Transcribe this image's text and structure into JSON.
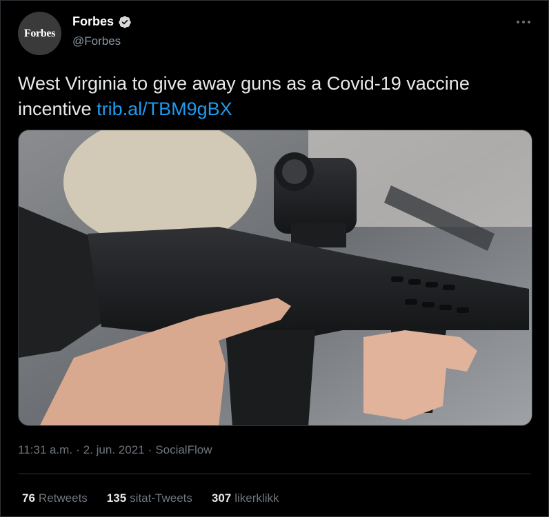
{
  "author": {
    "avatar_text": "Forbes",
    "display_name": "Forbes",
    "handle": "@Forbes",
    "verified": true
  },
  "tweet": {
    "text": "West Virginia to give away guns as a Covid-19 vaccine incentive ",
    "link": "trib.al/TBM9gBX"
  },
  "media": {
    "description": "photo"
  },
  "meta": {
    "time": "11:31 a.m.",
    "separator": "·",
    "date": "2. jun. 2021",
    "source": "SocialFlow"
  },
  "stats": [
    {
      "count": "76",
      "label": "Retweets"
    },
    {
      "count": "135",
      "label": "sitat-Tweets"
    },
    {
      "count": "307",
      "label": "likerklikk"
    }
  ],
  "colors": {
    "background": "#000000",
    "link": "#1d9bf0",
    "secondary_text": "#6e767d",
    "verified": "#d9d9d9"
  }
}
